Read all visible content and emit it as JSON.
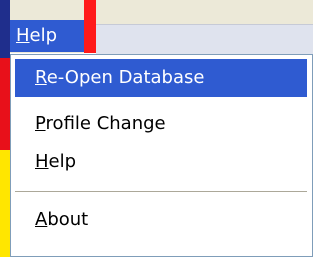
{
  "menubar": {
    "help_first": "H",
    "help_rest": "elp"
  },
  "menu": {
    "items": [
      {
        "first": "R",
        "rest": "e-Open Database",
        "selected": true
      },
      {
        "first": "P",
        "rest": "rofile Change",
        "selected": false
      },
      {
        "first": "H",
        "rest": "elp",
        "selected": false
      },
      {
        "first": "A",
        "rest": "bout",
        "selected": false
      }
    ]
  },
  "colors": {
    "selection": "#2f5bd1",
    "menu_border": "#7f9db9",
    "background_panel": "#ece9d8"
  }
}
